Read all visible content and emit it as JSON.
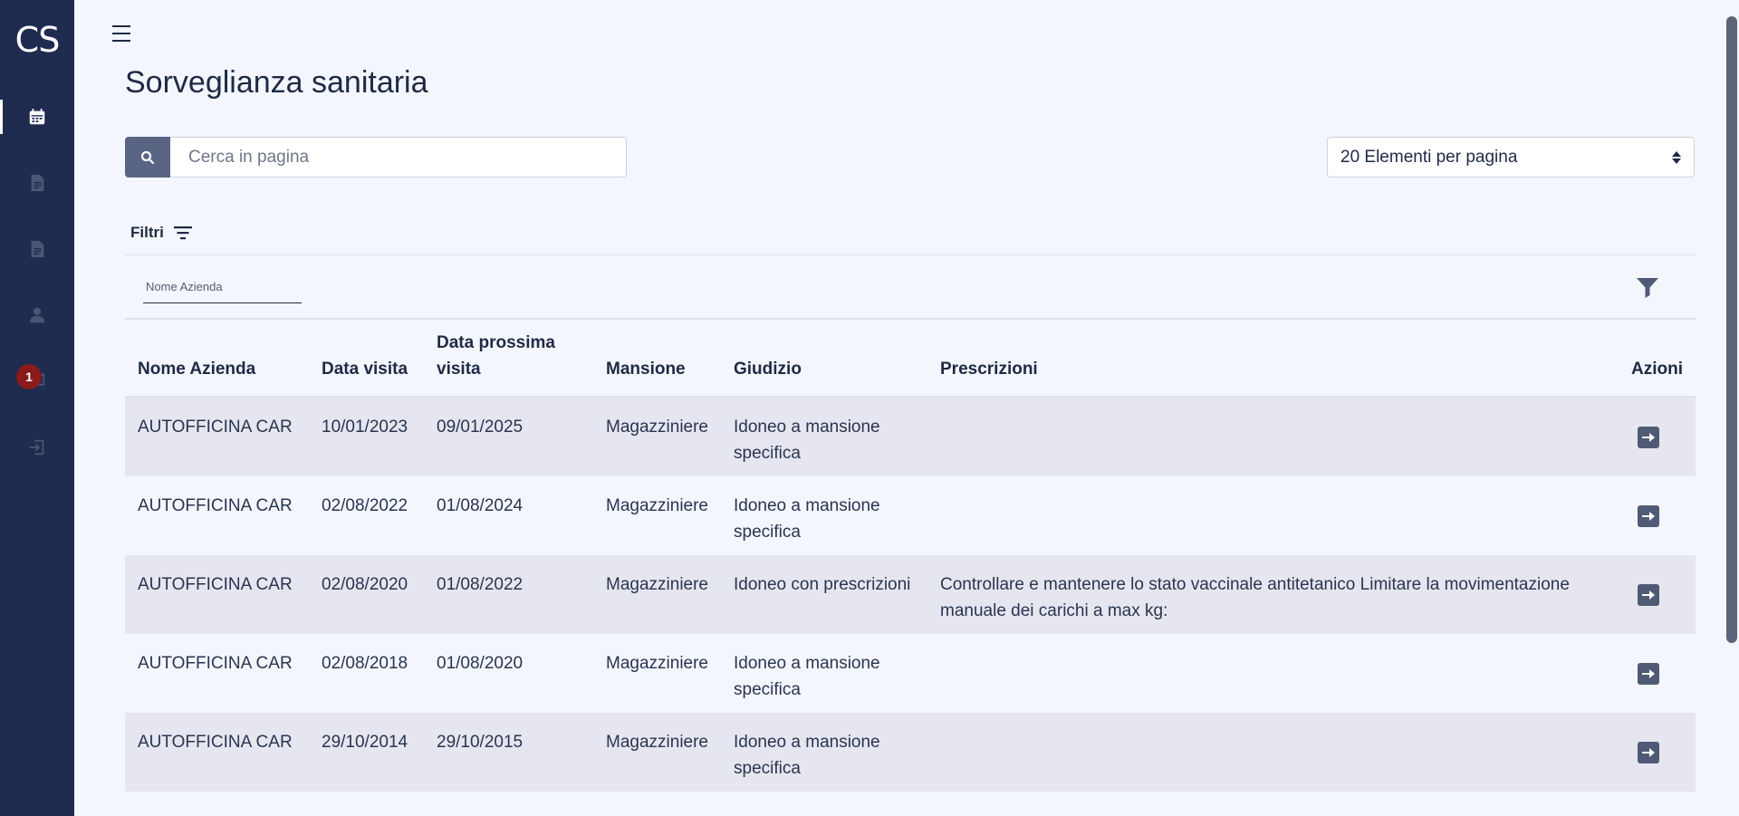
{
  "sidebar": {
    "logo": "CS",
    "items": [
      {
        "icon": "calendar-icon",
        "active": true
      },
      {
        "icon": "document-icon",
        "active": false
      },
      {
        "icon": "document-icon",
        "active": false
      },
      {
        "icon": "user-icon",
        "active": false
      },
      {
        "icon": "chat-icon",
        "active": false,
        "badge": "1"
      },
      {
        "icon": "logout-icon",
        "active": false
      }
    ]
  },
  "header": {
    "menu_icon": "hamburger-icon",
    "title": "Sorveglianza sanitaria"
  },
  "search": {
    "placeholder": "Cerca in pagina",
    "value": "",
    "icon": "search-icon"
  },
  "per_page": {
    "selected": "20 Elementi per pagina"
  },
  "filters": {
    "label": "Filtri",
    "fields": [
      {
        "label": "Nome Azienda",
        "value": ""
      }
    ]
  },
  "table": {
    "columns": [
      "Nome Azienda",
      "Data visita",
      "Data prossima visita",
      "Mansione",
      "Giudizio",
      "Prescrizioni",
      "Azioni"
    ],
    "rows": [
      {
        "azienda": "AUTOFFICINA CAR",
        "data_visita": "10/01/2023",
        "data_prossima": "09/01/2025",
        "mansione": "Magazziniere",
        "giudizio": "Idoneo a mansione specifica",
        "prescrizioni": ""
      },
      {
        "azienda": "AUTOFFICINA CAR",
        "data_visita": "02/08/2022",
        "data_prossima": "01/08/2024",
        "mansione": "Magazziniere",
        "giudizio": "Idoneo a mansione specifica",
        "prescrizioni": ""
      },
      {
        "azienda": "AUTOFFICINA CAR",
        "data_visita": "02/08/2020",
        "data_prossima": "01/08/2022",
        "mansione": "Magazziniere",
        "giudizio": "Idoneo con prescrizioni",
        "prescrizioni": "Controllare e mantenere lo stato vaccinale antitetanico Limitare la movimentazione manuale dei carichi a max kg:"
      },
      {
        "azienda": "AUTOFFICINA CAR",
        "data_visita": "02/08/2018",
        "data_prossima": "01/08/2020",
        "mansione": "Magazziniere",
        "giudizio": "Idoneo a mansione specifica",
        "prescrizioni": ""
      },
      {
        "azienda": "AUTOFFICINA CAR",
        "data_visita": "29/10/2014",
        "data_prossima": "29/10/2015",
        "mansione": "Magazziniere",
        "giudizio": "Idoneo a mansione specifica",
        "prescrizioni": ""
      }
    ]
  },
  "colors": {
    "sidebar_bg": "#1f2b4f",
    "page_bg": "#f3f6fc",
    "row_alt_bg": "#e5e6ef",
    "button_bg": "#5a6483",
    "badge_bg": "#8b1a1a"
  }
}
